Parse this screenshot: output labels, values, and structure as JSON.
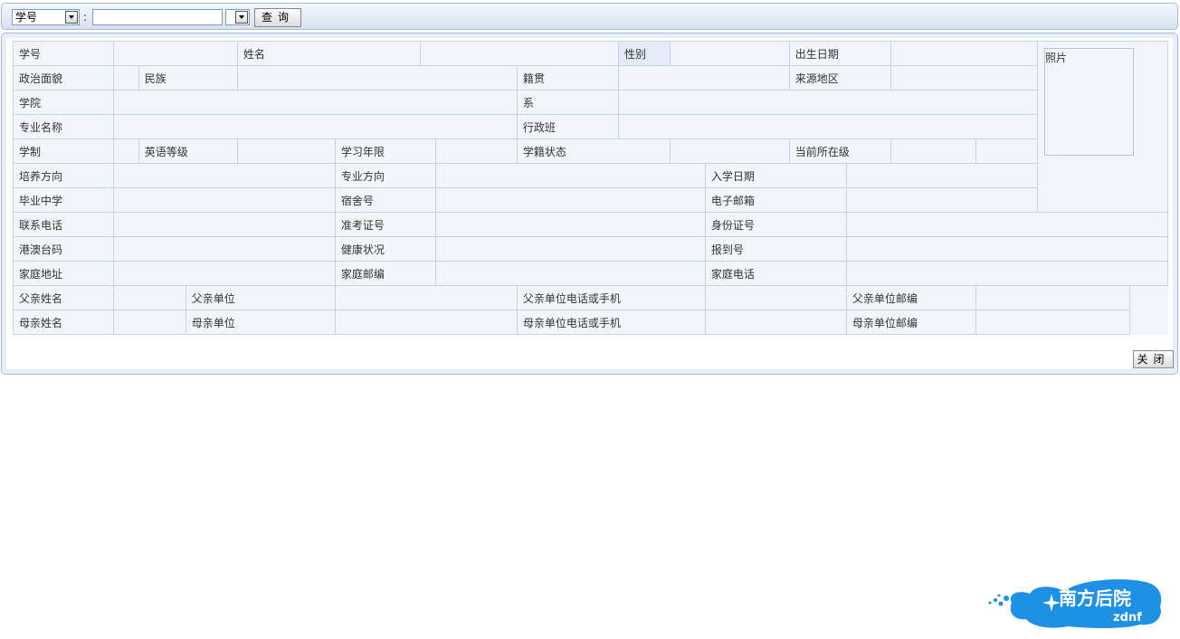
{
  "search": {
    "field_select": "学号",
    "separator": ":",
    "value_placeholder": "",
    "second_select": "",
    "query_button": "查询"
  },
  "table": {
    "r1": [
      "学号",
      "",
      "姓名",
      "",
      "性别",
      "",
      "出生日期",
      ""
    ],
    "photo_label": "照片",
    "r2": [
      "政治面貌",
      "",
      "民族",
      "",
      "籍贯",
      "",
      "来源地区",
      ""
    ],
    "r3": [
      "学院",
      "",
      "系",
      ""
    ],
    "r4": [
      "专业名称",
      "",
      "行政班",
      ""
    ],
    "r5": [
      "学制",
      "",
      "英语等级",
      "",
      "学习年限",
      "",
      "学籍状态",
      "",
      "当前所在级",
      ""
    ],
    "r6": [
      "培养方向",
      "",
      "专业方向",
      "",
      "入学日期",
      ""
    ],
    "r7": [
      "毕业中学",
      "",
      "宿舍号",
      "",
      "电子邮箱",
      ""
    ],
    "r8": [
      "联系电话",
      "",
      "准考证号",
      "",
      "身份证号",
      ""
    ],
    "r9": [
      "港澳台码",
      "",
      "健康状况",
      "",
      "报到号",
      ""
    ],
    "r10": [
      "家庭地址",
      "",
      "家庭邮编",
      "",
      "家庭电话",
      ""
    ],
    "r11": [
      "父亲姓名",
      "",
      "父亲单位",
      "",
      "父亲单位电话或手机",
      "",
      "父亲单位邮编",
      ""
    ],
    "r12": [
      "母亲姓名",
      "",
      "母亲单位",
      "",
      "母亲单位电话或手机",
      "",
      "母亲单位邮编",
      ""
    ]
  },
  "close_button": "关闭",
  "logo": {
    "text": "南方后院",
    "sub": "zdnf",
    "color": "#1e90e6"
  }
}
